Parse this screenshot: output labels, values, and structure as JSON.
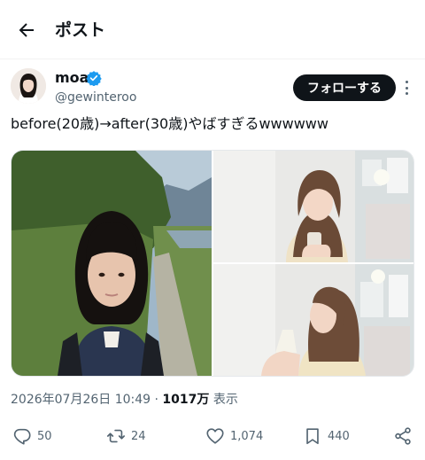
{
  "header": {
    "title": "ポスト"
  },
  "author": {
    "name": "moa",
    "handle": "@gewinteroo",
    "follow_label": "フォローする"
  },
  "post": {
    "text": "before(20歳)→after(30歳)やばすぎるwwwwww",
    "timestamp": "2026年07月26日 10:49",
    "separator": "·",
    "views_count": "1017万",
    "views_label": "表示"
  },
  "actions": {
    "replies": "50",
    "reposts": "24",
    "likes": "1,074",
    "bookmarks": "440"
  },
  "colors": {
    "verified": "#1d9bf0",
    "follow_button": "#0f1419",
    "secondary_text": "#536471"
  },
  "icons": [
    "back-arrow-icon",
    "verified-badge-icon",
    "more-icon",
    "reply-icon",
    "repost-icon",
    "like-icon",
    "bookmark-icon",
    "share-icon"
  ]
}
